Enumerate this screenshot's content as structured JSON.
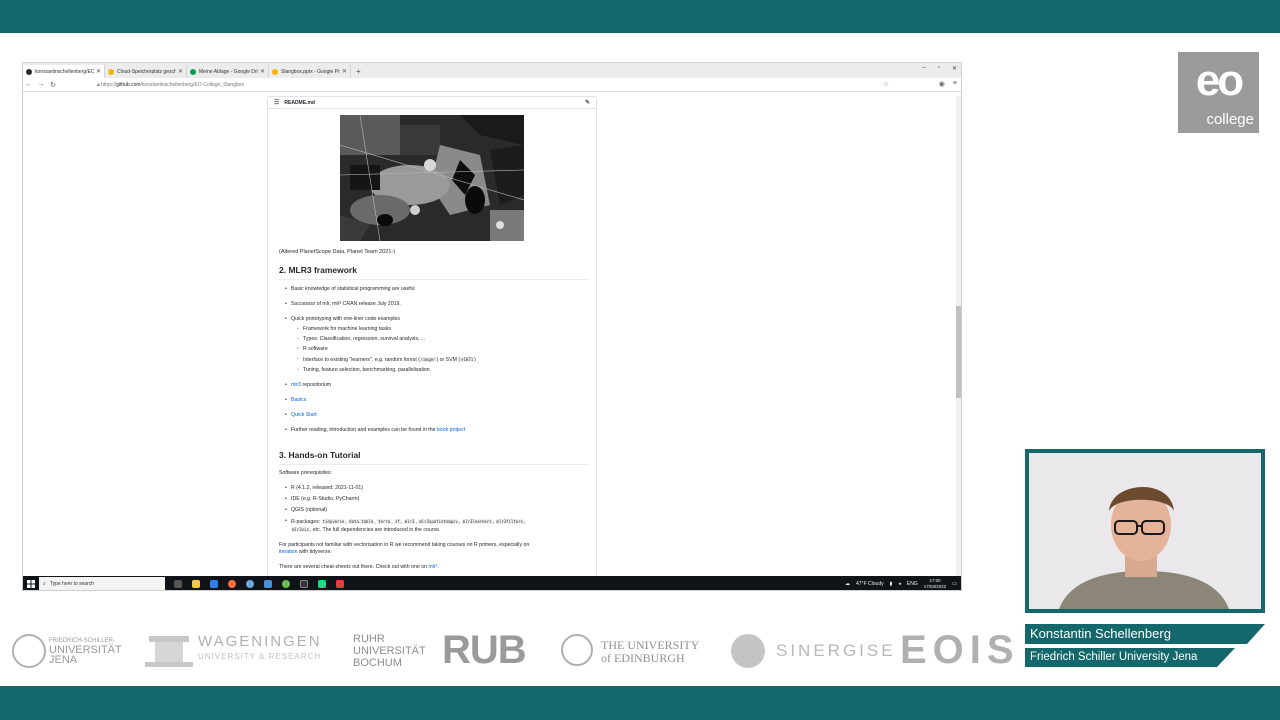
{
  "colors": {
    "teal": "#14676a",
    "link": "#0366d6",
    "taskbar": "#101418"
  },
  "browser": {
    "tabs": [
      {
        "label": "konstantinschellenberg/EO-Co",
        "favicon": "github-icon",
        "color": "#24292e",
        "active": true
      },
      {
        "label": "Cloud-Speicherplatz geschäftl",
        "favicon": "drive-icon",
        "color": "#f4b400",
        "active": false
      },
      {
        "label": "Meine Ablage - Google Drive",
        "favicon": "drive-icon",
        "color": "#0f9d58",
        "active": false
      },
      {
        "label": "Slangbox.pptx - Google Präsen",
        "favicon": "slides-icon",
        "color": "#f4b400",
        "active": false
      }
    ],
    "new_tab": "+",
    "window_controls": [
      "–",
      "▫",
      "✕"
    ],
    "url_prefix": "https://",
    "url_host": "github.com",
    "url_path": "/konstantinschellenberg/EO-College_Slangbox"
  },
  "readme": {
    "filename": "README.md",
    "caption": "(Altered PlanetScope Data, Planet Team 2021-)",
    "section2": {
      "title": "2. MLR3 framework",
      "b1": "Basic knowledge of statistical programming are useful",
      "b2": "Successor of mlr, mlr³ CRAN release July 2019.",
      "b3": "Quick prototyping with one-liner code examples",
      "sub1": "Framework for machine learning tasks",
      "sub2": "Types: Classification, regression, survival analysis, ...",
      "sub3": "R software",
      "sub4_a": "Interface to existing \"learners\", e.g. random forest (",
      "sub4_code1": "ranger",
      "sub4_b": ") or SVM (",
      "sub4_code2": "e1071",
      "sub4_c": ")",
      "sub5": "Tuning, feature selection, benchmarking, parallelisation",
      "b4_link": "mlr3",
      "b4_rest": " repositorium",
      "b5_link": "Basics",
      "b6_link": "Quick Start",
      "b7_text": "Further reading, introduction and examples can be found in the ",
      "b7_link": "book project"
    },
    "section3": {
      "title": "3. Hands-on Tutorial",
      "intro": "Software prerequisites:",
      "b1": "R (4.1.2, released: 2021-11-01)",
      "b2": "IDE (e.g. R-Studio, PyCharm)",
      "b3": "QGIS (optional)",
      "b4_label": "R-packages: ",
      "pkgs": [
        "tidyverse",
        "data.table",
        "terra",
        "sf",
        "mlr3",
        "mlr3spatiotempcv",
        "mlr3learners",
        "mlr3filters"
      ],
      "pkg_last": "mlr3viz",
      "b4_rest": ", etc. The full dependencies are introduced in the course.",
      "p1_a": "For participants not familiar with vectorisation in R we recommend taking courses on R primers, especially on",
      "p1_link": "iteration",
      "p1_b": " with tidyverse.",
      "p2_a": "There are several cheat-sheets out there. Check out with one on ",
      "p2_link": "mlr³",
      "p2_b": "."
    }
  },
  "taskbar": {
    "search_placeholder": "Type here to search",
    "weather": "47°F Cloudy",
    "lang": "ENG",
    "time": "17:00",
    "date": "17/03/2022"
  },
  "branding": {
    "logo_main": "eo",
    "logo_sub": "college",
    "speaker_name": "Konstantin Schellenberg",
    "speaker_affiliation": "Friedrich Schiller University Jena"
  },
  "partners": {
    "jena_small": "FRIEDRICH-SCHILLER-",
    "jena_big_1": "UNIVERSITÄT",
    "jena_big_2": "JENA",
    "wag_1": "WAGENINGEN",
    "wag_2": "UNIVERSITY & RESEARCH",
    "ruhr_1": "RUHR",
    "ruhr_2": "UNIVERSITÄT",
    "ruhr_3": "BOCHUM",
    "rub": "RUB",
    "edi_1": "THE UNIVERSITY",
    "edi_2": "of EDINBURGH",
    "sinergise": "SINERGISE",
    "eois": "EOIS"
  }
}
